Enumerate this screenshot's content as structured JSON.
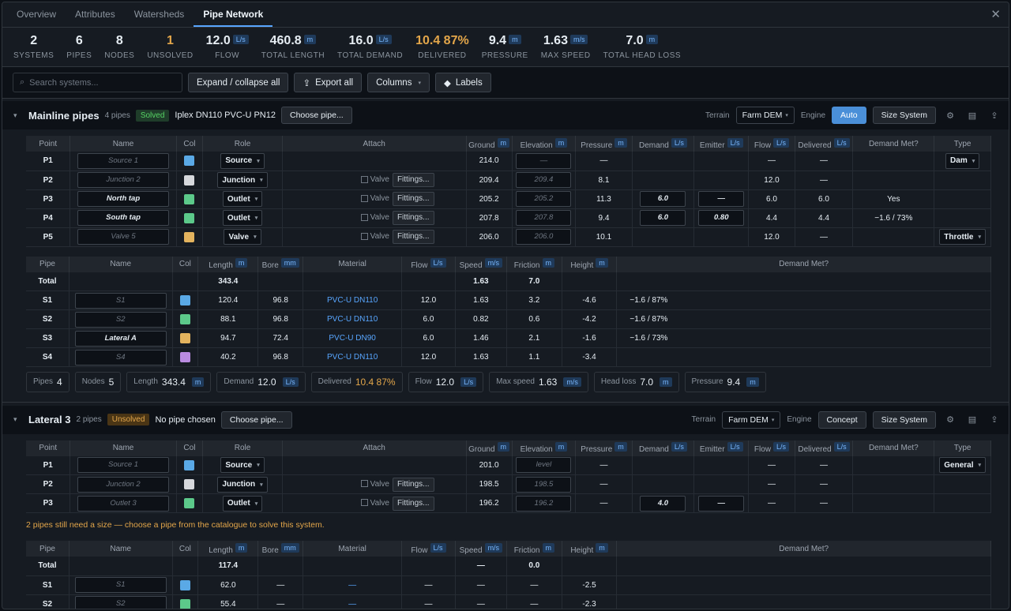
{
  "tabs": [
    "Overview",
    "Attributes",
    "Watersheds",
    "Pipe Network"
  ],
  "active_tab": 3,
  "stats": [
    {
      "value": "2",
      "unit": "",
      "label": "SYSTEMS"
    },
    {
      "value": "6",
      "unit": "",
      "label": "PIPES"
    },
    {
      "value": "8",
      "unit": "",
      "label": "NODES"
    },
    {
      "value": "1",
      "unit": "",
      "label": "UNSOLVED",
      "orange": true
    },
    {
      "value": "12.0",
      "unit": "L/s",
      "label": "FLOW"
    },
    {
      "value": "460.8",
      "unit": "m",
      "label": "TOTAL LENGTH"
    },
    {
      "value": "16.0",
      "unit": "L/s",
      "label": "TOTAL DEMAND"
    },
    {
      "value": "10.4 87%",
      "unit": "",
      "label": "DELIVERED",
      "orange": true
    },
    {
      "value": "9.4",
      "unit": "m",
      "label": "PRESSURE"
    },
    {
      "value": "1.63",
      "unit": "m/s",
      "label": "MAX SPEED"
    },
    {
      "value": "7.0",
      "unit": "m",
      "label": "TOTAL HEAD LOSS"
    }
  ],
  "toolbar": {
    "search_placeholder": "Search systems...",
    "expand": "Expand / collapse all",
    "export": "Export all",
    "columns": "Columns",
    "labels": "Labels"
  },
  "node_headers": [
    "Point",
    "Name",
    "Col",
    "Role",
    "Attach",
    "Ground",
    "Elevation",
    "Pressure",
    "Demand",
    "Emitter",
    "Flow",
    "Delivered",
    "Demand Met?",
    "Type"
  ],
  "node_units": [
    "",
    "",
    "",
    "",
    "",
    "m",
    "m",
    "m",
    "L/s",
    "L/s",
    "L/s",
    "L/s",
    "",
    ""
  ],
  "pipe_headers": [
    "Pipe",
    "Name",
    "Col",
    "Length",
    "Bore",
    "Material",
    "Flow",
    "Speed",
    "Friction",
    "Height",
    "Demand Met?"
  ],
  "pipe_units": [
    "",
    "",
    "",
    "m",
    "mm",
    "",
    "L/s",
    "m/s",
    "m",
    "m",
    ""
  ],
  "systems": [
    {
      "title": "Mainline pipes",
      "count": "4 pipes",
      "status": "Solved",
      "pipe": "Iplex DN110 PVC-U PN12",
      "choose": "Choose pipe...",
      "terrain_label": "Terrain",
      "terrain": "Farm DEM",
      "engine_label": "Engine",
      "engine": "Auto",
      "size": "Size System",
      "nodes": [
        {
          "id": "P1",
          "name": "Source 1",
          "filled": false,
          "color": "#5aa9e6",
          "role": "Source",
          "attach": false,
          "ground": "214.0",
          "elev": "—",
          "pressure": "—",
          "demand": "",
          "emitter": "",
          "flow": "—",
          "delivered": "—",
          "met": "",
          "type": "Dam"
        },
        {
          "id": "P2",
          "name": "Junction 2",
          "filled": false,
          "color": "#d6d8dc",
          "role": "Junction",
          "attach": true,
          "valve": "Valve",
          "fit": "Fittings...",
          "ground": "209.4",
          "elev": "209.4",
          "pressure": "8.1",
          "demand": "",
          "emitter": "",
          "flow": "12.0",
          "delivered": "—",
          "met": "",
          "type": ""
        },
        {
          "id": "P3",
          "name": "North tap",
          "filled": true,
          "color": "#5cc98a",
          "role": "Outlet",
          "attach": true,
          "valve": "Valve",
          "fit": "Fittings...",
          "ground": "205.2",
          "elev": "205.2",
          "pressure": "11.3",
          "demand": "6.0",
          "emitter": "—",
          "flow": "6.0",
          "delivered": "6.0",
          "met": "Yes",
          "type": ""
        },
        {
          "id": "P4",
          "name": "South tap",
          "filled": true,
          "color": "#5cc98a",
          "role": "Outlet",
          "attach": true,
          "valve": "Valve",
          "fit": "Fittings...",
          "ground": "207.8",
          "elev": "207.8",
          "pressure": "9.4",
          "demand": "6.0",
          "emitter": "0.80",
          "flow": "4.4",
          "delivered": "4.4",
          "met": "−1.6 / 73%",
          "type": ""
        },
        {
          "id": "P5",
          "name": "Valve 5",
          "filled": false,
          "color": "#e3b35e",
          "role": "Valve",
          "attach": true,
          "valve": "Valve",
          "fit": "Fittings...",
          "ground": "206.0",
          "elev": "206.0",
          "pressure": "10.1",
          "demand": "",
          "emitter": "",
          "flow": "12.0",
          "delivered": "—",
          "met": "",
          "type": "Throttle"
        }
      ],
      "pipe_total": {
        "label": "Total",
        "length": "343.4",
        "speed": "1.63",
        "friction": "7.0"
      },
      "pipes": [
        {
          "id": "S1",
          "name": "S1",
          "filled": false,
          "color": "#5aa9e6",
          "length": "120.4",
          "bore": "96.8",
          "material": "PVC-U DN110",
          "flow": "12.0",
          "speed": "1.63",
          "friction": "3.2",
          "height": "-4.6",
          "met": "−1.6 / 87%"
        },
        {
          "id": "S2",
          "name": "S2",
          "filled": false,
          "color": "#5cc98a",
          "length": "88.1",
          "bore": "96.8",
          "material": "PVC-U DN110",
          "flow": "6.0",
          "speed": "0.82",
          "friction": "0.6",
          "height": "-4.2",
          "met": "−1.6 / 87%"
        },
        {
          "id": "S3",
          "name": "Lateral A",
          "filled": true,
          "color": "#e3b35e",
          "length": "94.7",
          "bore": "72.4",
          "material": "PVC-U DN90",
          "flow": "6.0",
          "speed": "1.46",
          "friction": "2.1",
          "height": "-1.6",
          "met": "−1.6 / 73%"
        },
        {
          "id": "S4",
          "name": "S4",
          "filled": false,
          "color": "#b98be0",
          "length": "40.2",
          "bore": "96.8",
          "material": "PVC-U DN110",
          "flow": "12.0",
          "speed": "1.63",
          "friction": "1.1",
          "height": "-3.4",
          "met": ""
        }
      ],
      "summary": [
        {
          "label": "Pipes",
          "value": "4",
          "unit": ""
        },
        {
          "label": "Nodes",
          "value": "5",
          "unit": ""
        },
        {
          "label": "Length",
          "value": "343.4",
          "unit": "m"
        },
        {
          "label": "Demand",
          "value": "12.0",
          "unit": "L/s"
        },
        {
          "label": "Delivered",
          "value": "10.4 87%",
          "unit": "",
          "orange": true
        },
        {
          "label": "Flow",
          "value": "12.0",
          "unit": "L/s"
        },
        {
          "label": "Max speed",
          "value": "1.63",
          "unit": "m/s"
        },
        {
          "label": "Head loss",
          "value": "7.0",
          "unit": "m"
        },
        {
          "label": "Pressure",
          "value": "9.4",
          "unit": "m"
        }
      ]
    },
    {
      "title": "Lateral 3",
      "count": "2 pipes",
      "status": "Unsolved",
      "pipe": "No pipe chosen",
      "choose": "Choose pipe...",
      "terrain_label": "Terrain",
      "terrain": "Farm DEM",
      "engine_label": "Engine",
      "engine": "Concept",
      "size": "Size System",
      "nodes": [
        {
          "id": "P1",
          "name": "Source 1",
          "filled": false,
          "color": "#5aa9e6",
          "role": "Source",
          "attach": false,
          "ground": "201.0",
          "elev": "level",
          "pressure": "—",
          "demand": "",
          "emitter": "",
          "flow": "—",
          "delivered": "—",
          "met": "",
          "type": "General"
        },
        {
          "id": "P2",
          "name": "Junction 2",
          "filled": false,
          "color": "#d6d8dc",
          "role": "Junction",
          "attach": true,
          "valve": "Valve",
          "fit": "Fittings...",
          "ground": "198.5",
          "elev": "198.5",
          "pressure": "—",
          "demand": "",
          "emitter": "",
          "flow": "—",
          "delivered": "—",
          "met": "",
          "type": ""
        },
        {
          "id": "P3",
          "name": "Outlet 3",
          "filled": false,
          "color": "#5cc98a",
          "role": "Outlet",
          "attach": true,
          "valve": "Valve",
          "fit": "Fittings...",
          "ground": "196.2",
          "elev": "196.2",
          "pressure": "—",
          "demand": "4.0",
          "emitter": "—",
          "flow": "—",
          "delivered": "—",
          "met": "",
          "type": ""
        }
      ],
      "warning": "2 pipes still need a size — choose a pipe from the catalogue to solve this system.",
      "pipe_total": {
        "label": "Total",
        "length": "117.4",
        "speed": "—",
        "friction": "0.0"
      },
      "pipes": [
        {
          "id": "S1",
          "name": "S1",
          "filled": false,
          "color": "#5aa9e6",
          "length": "62.0",
          "bore": "—",
          "material": "—",
          "flow": "—",
          "speed": "—",
          "friction": "—",
          "height": "-2.5",
          "met": ""
        },
        {
          "id": "S2",
          "name": "S2",
          "filled": false,
          "color": "#5cc98a",
          "length": "55.4",
          "bore": "—",
          "material": "—",
          "flow": "—",
          "speed": "—",
          "friction": "—",
          "height": "-2.3",
          "met": ""
        }
      ]
    }
  ]
}
